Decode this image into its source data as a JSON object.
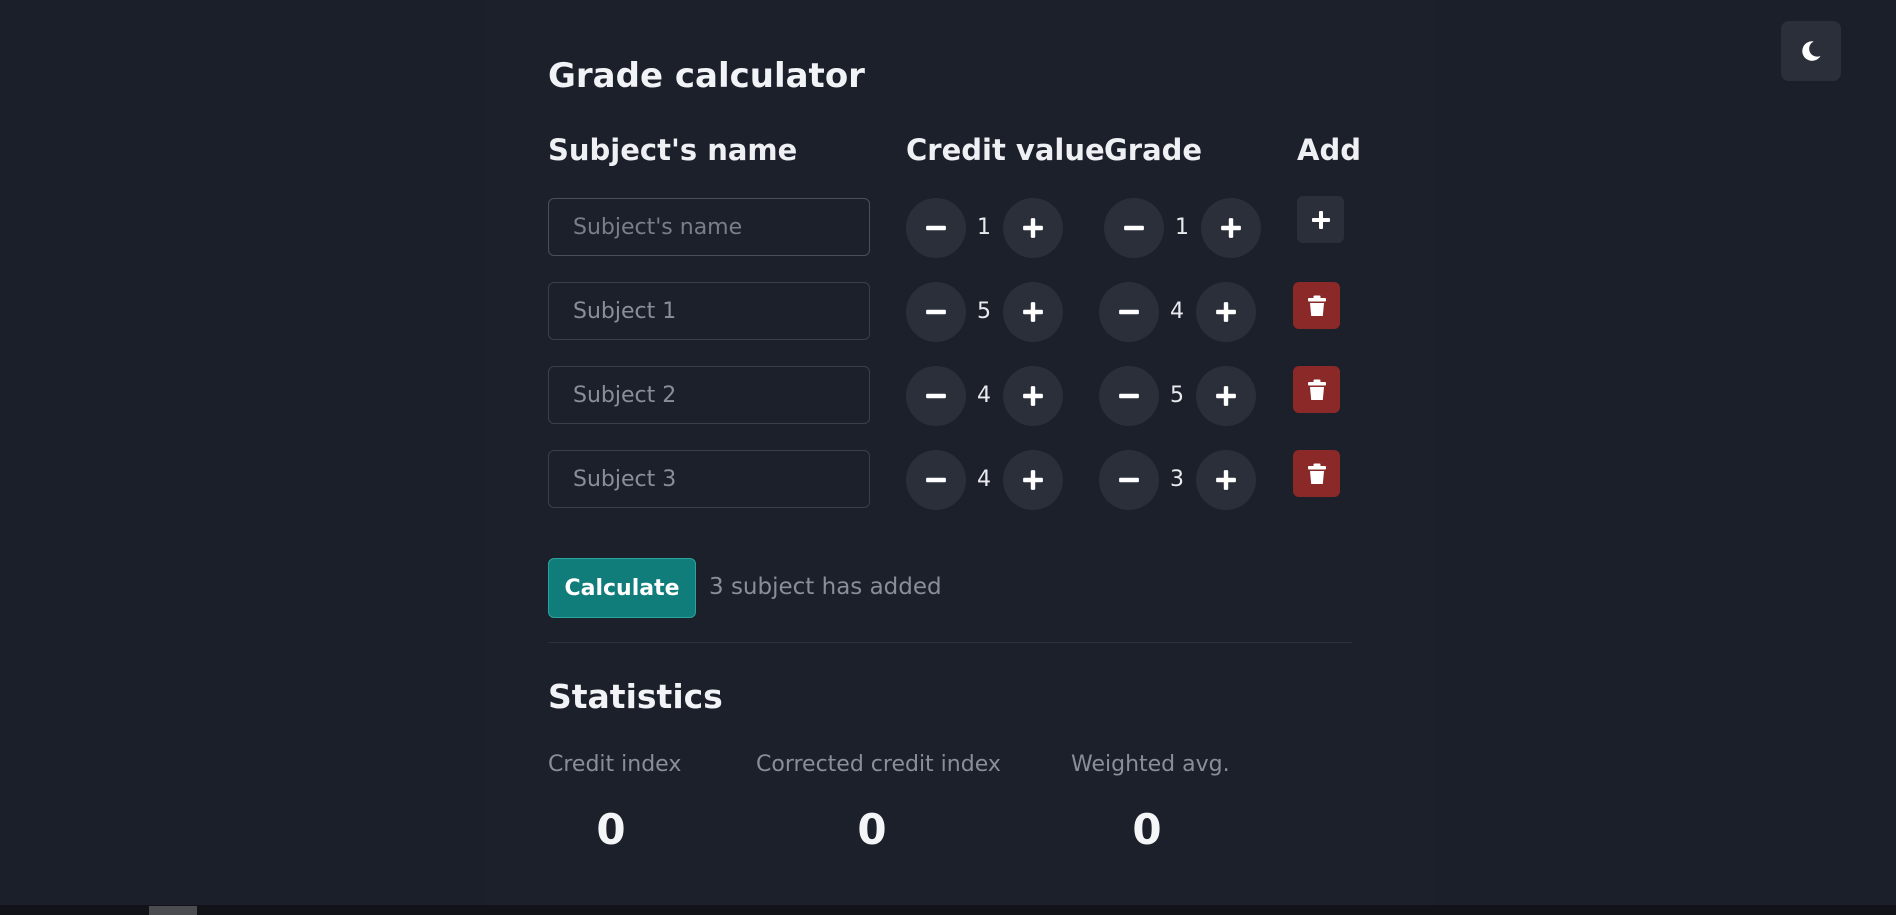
{
  "app": {
    "title": "Grade calculator",
    "accent": "#107d7b",
    "danger": "#8b2828"
  },
  "theme_toggle": {
    "icon": "moon-icon"
  },
  "columns": {
    "name": "Subject's name",
    "credit": "Credit value",
    "grade": "Grade",
    "add": "Add"
  },
  "new_subject": {
    "placeholder": "Subject's name",
    "value": "",
    "credit": "1",
    "grade": "1"
  },
  "subjects": [
    {
      "name": "Subject 1",
      "credit": "5",
      "grade": "4"
    },
    {
      "name": "Subject 2",
      "credit": "4",
      "grade": "5"
    },
    {
      "name": "Subject 3",
      "credit": "4",
      "grade": "3"
    }
  ],
  "actions": {
    "calculate_label": "Calculate",
    "status_text": "3 subject has added"
  },
  "statistics": {
    "title": "Statistics",
    "credit_index_label": "Credit index",
    "credit_index_value": "0",
    "corrected_credit_index_label": "Corrected credit index",
    "corrected_credit_index_value": "0",
    "weighted_avg_label": "Weighted avg.",
    "weighted_avg_value": "0"
  }
}
